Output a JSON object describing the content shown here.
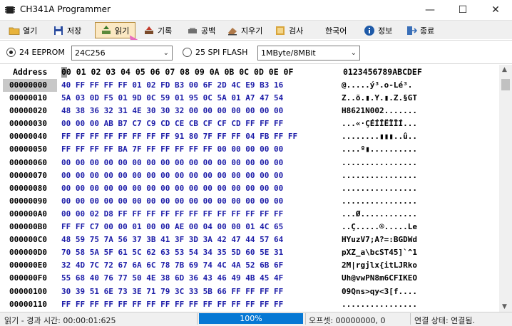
{
  "window": {
    "title": "CH341A Programmer"
  },
  "toolbar": {
    "open": "열기",
    "save": "저장",
    "read": "읽기",
    "erase": "기록",
    "blank": "공백",
    "erase_chip": "지우기",
    "verify": "검사",
    "language": "한국어",
    "info": "정보",
    "exit": "종료"
  },
  "chip": {
    "eeprom_label": "24 EEPROM",
    "eeprom_selected": true,
    "eeprom_model": "24C256",
    "spi_label": "25 SPI FLASH",
    "spi_selected": false,
    "spi_size": "1MByte/8MBit"
  },
  "hex": {
    "header_address": "Address",
    "header_columns": [
      "00",
      "01",
      "02",
      "03",
      "04",
      "05",
      "06",
      "07",
      "08",
      "09",
      "0A",
      "0B",
      "0C",
      "0D",
      "0E",
      "0F"
    ],
    "header_ascii": "0123456789ABCDEF",
    "rows": [
      {
        "addr": "00000000",
        "hex": "40 FF FF FF FF 01 02 FD B3 00 6F 2D 4C E9 B3 16",
        "ascii": "@.....ý³.o-Lé³."
      },
      {
        "addr": "00000010",
        "hex": "5A 03 0D F5 01 9D 0C 59 01 95 0C 5A 01 A7 47 54",
        "ascii": "Z..õ.▮.Y.▮.Z.§GT"
      },
      {
        "addr": "00000020",
        "hex": "48 38 36 32 31 4E 30 30 32 00 00 00 00 00 00 00",
        "ascii": "H8621N002......."
      },
      {
        "addr": "00000030",
        "hex": "00 00 00 AB B7 C7 C9 CD CE CB CF CF CD FF FF FF",
        "ascii": "...«·ÇÉÍÎËÏÏÍ..."
      },
      {
        "addr": "00000040",
        "hex": "FF FF FF FF FF FF FF FF 91 80 7F FF FF 04 FB FF FF",
        "ascii": "........▮▮▮..û.."
      },
      {
        "addr": "00000050",
        "hex": "FF FF FF FF BA 7F FF FF FF FF FF 00 00 00 00 00",
        "ascii": "....º▮.........."
      },
      {
        "addr": "00000060",
        "hex": "00 00 00 00 00 00 00 00 00 00 00 00 00 00 00 00",
        "ascii": "................"
      },
      {
        "addr": "00000070",
        "hex": "00 00 00 00 00 00 00 00 00 00 00 00 00 00 00 00",
        "ascii": "................"
      },
      {
        "addr": "00000080",
        "hex": "00 00 00 00 00 00 00 00 00 00 00 00 00 00 00 00",
        "ascii": "................"
      },
      {
        "addr": "00000090",
        "hex": "00 00 00 00 00 00 00 00 00 00 00 00 00 00 00 00",
        "ascii": "................"
      },
      {
        "addr": "000000A0",
        "hex": "00 00 02 D8 FF FF FF FF FF FF FF FF FF FF FF FF",
        "ascii": "...Ø............"
      },
      {
        "addr": "000000B0",
        "hex": "FF FF C7 00 00 01 00 00 AE 00 04 00 00 01 4C 65",
        "ascii": "..Ç.....®.....Le"
      },
      {
        "addr": "000000C0",
        "hex": "48 59 75 7A 56 37 3B 41 3F 3D 3A 42 47 44 57 64",
        "ascii": "HYuzV7;A?=:BGDWd"
      },
      {
        "addr": "000000D0",
        "hex": "70 58 5A 5F 61 5C 62 63 53 54 34 35 5D 60 5E 31",
        "ascii": "pXZ_a\\bcST45]`^1"
      },
      {
        "addr": "000000E0",
        "hex": "32 4D 7C 72 67 6A 6C 78 7B 69 74 4C 4A 52 6B 6F",
        "ascii": "2M|rgjlx{itLJRko"
      },
      {
        "addr": "000000F0",
        "hex": "55 68 40 76 77 50 4E 38 6D 36 43 46 49 4B 45 4F",
        "ascii": "Uh@vwPN8m6CFIKEO"
      },
      {
        "addr": "00000100",
        "hex": "30 39 51 6E 73 3E 71 79 3C 33 5B 66 FF FF FF FF",
        "ascii": "09Qns>qy<3[f...."
      },
      {
        "addr": "00000110",
        "hex": "FF FF FF FF FF FF FF FF FF FF FF FF FF FF FF FF",
        "ascii": "................"
      }
    ]
  },
  "status": {
    "elapsed_label": "읽기 - 경과 시간: 00:00:01:625",
    "progress_text": "100%",
    "progress_value": 100,
    "offset": "오프셋: 00000000, 0",
    "connection": "연결 상태: 연결됨."
  },
  "colors": {
    "hex_text": "#1c1ca8",
    "progress": "#0678d4",
    "active_tool": "#fbe8c3"
  }
}
